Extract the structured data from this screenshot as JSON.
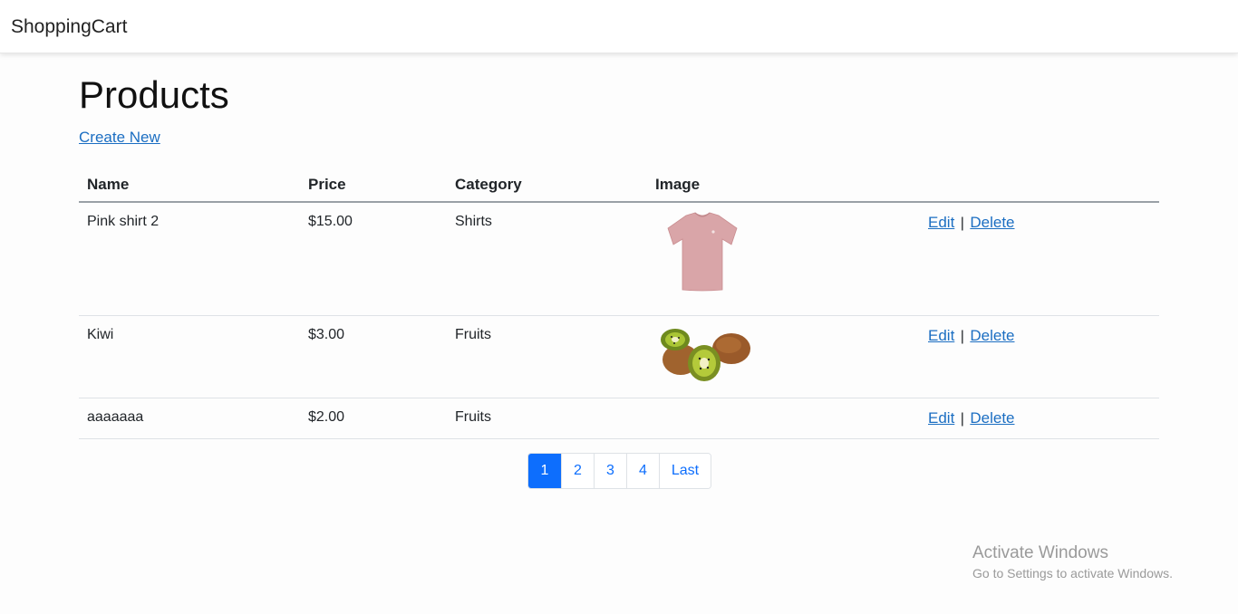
{
  "navbar": {
    "brand": "ShoppingCart"
  },
  "page": {
    "title": "Products",
    "create_link": "Create New"
  },
  "table": {
    "headers": [
      "Name",
      "Price",
      "Category",
      "Image",
      ""
    ],
    "rows": [
      {
        "name": "Pink shirt 2",
        "price": "$15.00",
        "category": "Shirts",
        "image": "pink-tshirt-image",
        "edit": "Edit",
        "sep": "|",
        "delete": "Delete"
      },
      {
        "name": "Kiwi",
        "price": "$3.00",
        "category": "Fruits",
        "image": "kiwi-fruit-image",
        "edit": "Edit",
        "sep": "|",
        "delete": "Delete"
      },
      {
        "name": "aaaaaaa",
        "price": "$2.00",
        "category": "Fruits",
        "image": "",
        "edit": "Edit",
        "sep": "|",
        "delete": "Delete"
      }
    ]
  },
  "pagination": {
    "pages": [
      "1",
      "2",
      "3",
      "4",
      "Last"
    ],
    "active": "1"
  },
  "watermark": {
    "title": "Activate Windows",
    "subtitle": "Go to Settings to activate Windows."
  },
  "colors": {
    "link": "#1b6ec2",
    "primary": "#0d6efd",
    "shirt": "#d9a5a8"
  }
}
